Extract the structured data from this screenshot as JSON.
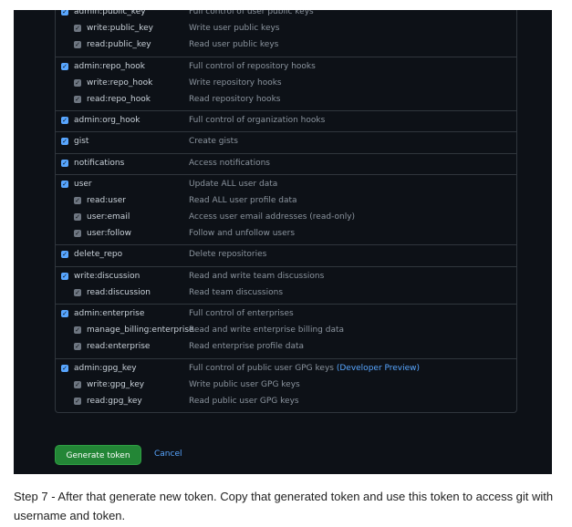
{
  "colors": {
    "accent": "#58a6ff",
    "background": "#0d1117",
    "button": "#238636"
  },
  "groups": [
    {
      "rows": [
        {
          "scope": "admin:public_key",
          "desc": "Full control of user public keys",
          "child": false
        },
        {
          "scope": "write:public_key",
          "desc": "Write user public keys",
          "child": true
        },
        {
          "scope": "read:public_key",
          "desc": "Read user public keys",
          "child": true
        }
      ]
    },
    {
      "rows": [
        {
          "scope": "admin:repo_hook",
          "desc": "Full control of repository hooks",
          "child": false
        },
        {
          "scope": "write:repo_hook",
          "desc": "Write repository hooks",
          "child": true
        },
        {
          "scope": "read:repo_hook",
          "desc": "Read repository hooks",
          "child": true
        }
      ]
    },
    {
      "rows": [
        {
          "scope": "admin:org_hook",
          "desc": "Full control of organization hooks",
          "child": false
        }
      ]
    },
    {
      "rows": [
        {
          "scope": "gist",
          "desc": "Create gists",
          "child": false
        }
      ]
    },
    {
      "rows": [
        {
          "scope": "notifications",
          "desc": "Access notifications",
          "child": false
        }
      ]
    },
    {
      "rows": [
        {
          "scope": "user",
          "desc": "Update ALL user data",
          "child": false
        },
        {
          "scope": "read:user",
          "desc": "Read ALL user profile data",
          "child": true
        },
        {
          "scope": "user:email",
          "desc": "Access user email addresses (read-only)",
          "child": true
        },
        {
          "scope": "user:follow",
          "desc": "Follow and unfollow users",
          "child": true
        }
      ]
    },
    {
      "rows": [
        {
          "scope": "delete_repo",
          "desc": "Delete repositories",
          "child": false
        }
      ]
    },
    {
      "rows": [
        {
          "scope": "write:discussion",
          "desc": "Read and write team discussions",
          "child": false
        },
        {
          "scope": "read:discussion",
          "desc": "Read team discussions",
          "child": true
        }
      ]
    },
    {
      "rows": [
        {
          "scope": "admin:enterprise",
          "desc": "Full control of enterprises",
          "child": false
        },
        {
          "scope": "manage_billing:enterprise",
          "desc": "Read and write enterprise billing data",
          "child": true
        },
        {
          "scope": "read:enterprise",
          "desc": "Read enterprise profile data",
          "child": true
        }
      ]
    },
    {
      "rows": [
        {
          "scope": "admin:gpg_key",
          "desc": "Full control of public user GPG keys",
          "link": "(Developer Preview)",
          "child": false
        },
        {
          "scope": "write:gpg_key",
          "desc": "Write public user GPG keys",
          "child": true
        },
        {
          "scope": "read:gpg_key",
          "desc": "Read public user GPG keys",
          "child": true
        }
      ]
    }
  ],
  "checkmark": "✓",
  "actions": {
    "generate": "Generate token",
    "cancel": "Cancel"
  },
  "caption": "Step 7 - After that generate new token. Copy that generated token and use this token to access git with username and token."
}
